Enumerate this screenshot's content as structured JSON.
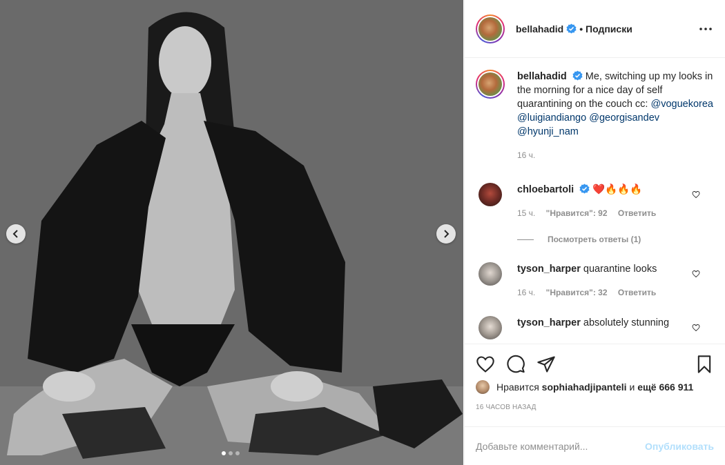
{
  "post": {
    "author": "bellahadid",
    "follow_status": "• Подписки",
    "caption_text": "Me, switching up my looks in the morning for a nice day of self quarantining on the couch cc:",
    "mentions": [
      "@voguekorea",
      "@luigiandiango",
      "@georgisandev",
      "@hyunji_nam"
    ],
    "caption_time": "16 ч.",
    "carousel": {
      "total": 3,
      "active": 1
    }
  },
  "comments": [
    {
      "user": "chloebartoli",
      "verified": true,
      "text": "❤️🔥🔥🔥",
      "time": "15 ч.",
      "likes": "\"Нравится\": 92",
      "reply": "Ответить"
    },
    {
      "user": "tyson_harper",
      "verified": false,
      "text": "quarantine looks",
      "time": "16 ч.",
      "likes": "\"Нравится\": 32",
      "reply": "Ответить"
    },
    {
      "user": "tyson_harper",
      "verified": false,
      "text": "absolutely stunning"
    }
  ],
  "view_replies": "Посмотреть ответы (1)",
  "likes": {
    "prefix": "Нравится",
    "user": "sophiahadjipanteli",
    "conj": "и",
    "others": "ещё 666 911"
  },
  "posted_ago": "16 ЧАСОВ НАЗАД",
  "comment_box": {
    "placeholder": "Добавьте комментарий...",
    "publish": "Опубликовать"
  },
  "colors": {
    "verified": "#3897f0",
    "link": "#00376b",
    "publish_disabled": "#b2dffc"
  },
  "icons": [
    "chevron-left-icon",
    "chevron-right-icon",
    "more-icon",
    "verified-icon",
    "heart-icon",
    "comment-icon",
    "share-icon",
    "bookmark-icon"
  ]
}
